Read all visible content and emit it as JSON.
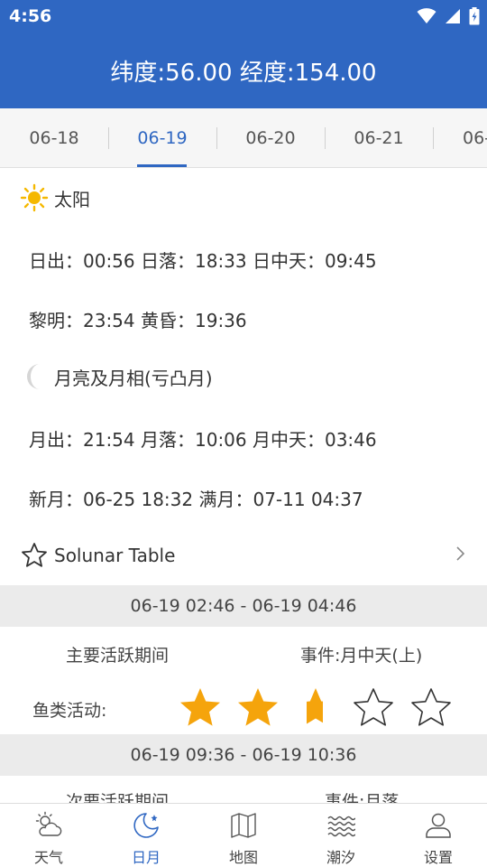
{
  "status_bar": {
    "time": "4:56"
  },
  "header": {
    "title": "纬度:56.00 经度:154.00"
  },
  "date_tabs": [
    "06-18",
    "06-19",
    "06-20",
    "06-21",
    "06-"
  ],
  "active_tab": "06-19",
  "sun": {
    "heading": "太阳",
    "icon": "sun-icon",
    "line1": "日出：00:56 日落：18:33  日中天：09:45",
    "line2": "黎明：23:54 黄昏：19:36"
  },
  "moon": {
    "heading": "月亮及月相(亏凸月)",
    "icon": "moon-icon",
    "line1": "月出：21:54 月落：10:06 月中天：03:46",
    "line2": "新月：06-25 18:32 满月：07-11 04:37"
  },
  "solunar": {
    "heading": "Solunar Table",
    "icon": "star-outline-icon",
    "periods": [
      {
        "range": "06-19 02:46 - 06-19 04:46",
        "type": "主要活跃期间",
        "event": "事件:月中天(上)",
        "fish_label": "鱼类活动:",
        "rating": 2.5,
        "max_rating": 5
      },
      {
        "range": "06-19 09:36 - 06-19 10:36",
        "type": "次要活跃期间",
        "event": "事件:月落"
      }
    ]
  },
  "bottom_nav": [
    {
      "label": "天气",
      "icon": "weather-icon",
      "active": false
    },
    {
      "label": "日月",
      "icon": "moon-star-icon",
      "active": true
    },
    {
      "label": "地图",
      "icon": "map-icon",
      "active": false
    },
    {
      "label": "潮汐",
      "icon": "waves-icon",
      "active": false
    },
    {
      "label": "设置",
      "icon": "user-icon",
      "active": false
    }
  ],
  "colors": {
    "primary": "#2f67c2",
    "star": "#f5a40c",
    "sun": "#f5b800"
  }
}
